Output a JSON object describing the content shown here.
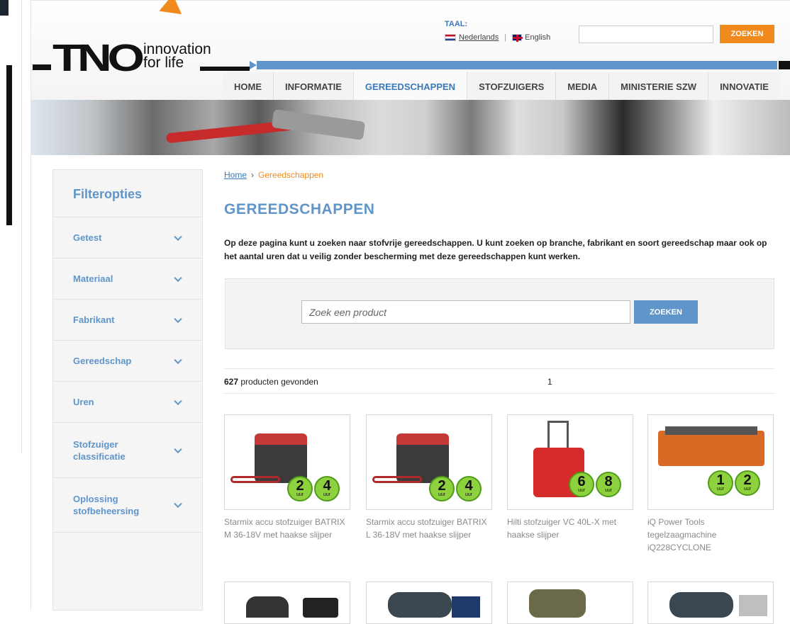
{
  "header": {
    "logo_brand": "TNO",
    "logo_tagline_1": "innovation",
    "logo_tagline_2": "for life",
    "taal_label": "TAAL:",
    "lang_nl": "Nederlands",
    "lang_en": "English",
    "lang_sep": "|",
    "top_search_button": "ZOEKEN"
  },
  "nav": {
    "items": [
      {
        "label": "HOME"
      },
      {
        "label": "INFORMATIE"
      },
      {
        "label": "GEREEDSCHAPPEN",
        "active": true
      },
      {
        "label": "STOFZUIGERS"
      },
      {
        "label": "MEDIA"
      },
      {
        "label": "MINISTERIE SZW"
      },
      {
        "label": "INNOVATIE"
      }
    ]
  },
  "sidebar": {
    "title": "Filteropties",
    "filters": [
      {
        "label": "Getest"
      },
      {
        "label": "Materiaal"
      },
      {
        "label": "Fabrikant"
      },
      {
        "label": "Gereedschap"
      },
      {
        "label": "Uren"
      },
      {
        "label": "Stofzuiger classificatie"
      },
      {
        "label": "Oplossing stofbeheersing"
      }
    ]
  },
  "breadcrumb": {
    "home": "Home",
    "sep": "›",
    "current": "Gereedschappen"
  },
  "main": {
    "title": "GEREEDSCHAPPEN",
    "intro": "Op deze pagina kunt u zoeken naar stofvrije gereedschappen. U kunt zoeken op branche, fabrikant en soort gereedschap maar ook op het aantal uren dat u veilig zonder bescherming met deze gereedschappen kunt werken.",
    "search_placeholder": "Zoek een product",
    "search_button": "ZOEKEN",
    "results_count": "627",
    "results_text": " producten gevonden",
    "results_page": "1"
  },
  "products": [
    {
      "title": "Starmix accu stofzuiger BATRIX M 36-18V met haakse slijper",
      "badge1": "2",
      "badge2": "4",
      "unit": "uur"
    },
    {
      "title": "Starmix accu stofzuiger BATRIX L 36-18V met haakse slijper",
      "badge1": "2",
      "badge2": "4",
      "unit": "uur"
    },
    {
      "title": "Hilti stofzuiger VC 40L-X met haakse slijper",
      "badge1": "6",
      "badge2": "8",
      "unit": "uur"
    },
    {
      "title": "iQ Power Tools tegelzaagmachine iQ228CYCLONE",
      "badge1": "1",
      "badge2": "2",
      "unit": "uur"
    }
  ],
  "colors": {
    "accent_blue": "#5f95c9",
    "accent_orange": "#f08a1c",
    "badge_green": "#8ed13e"
  }
}
